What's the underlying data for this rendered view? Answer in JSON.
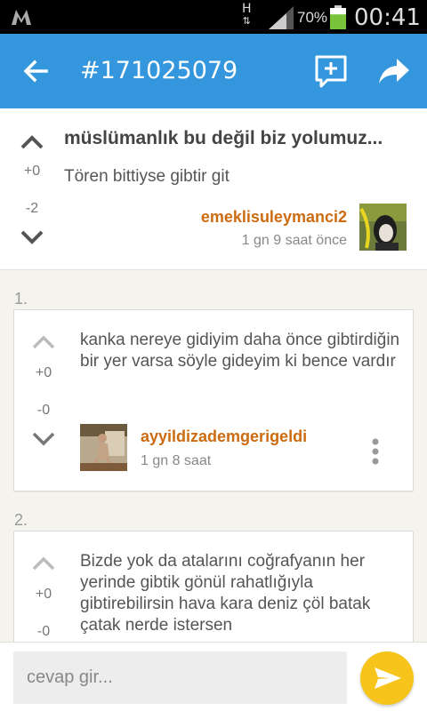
{
  "status_bar": {
    "network": "H",
    "battery_percent": "70%",
    "battery_level": 0.7,
    "time": "00:41"
  },
  "app_bar": {
    "title": "#171025079",
    "icons": [
      "back-arrow-icon",
      "add-comment-icon",
      "share-icon"
    ]
  },
  "post": {
    "title": "müslümanlık bu değil biz yolumuz...",
    "body": "Tören bittiyse gibtir git",
    "upvotes": "+0",
    "downvotes": "-2",
    "author": "emeklisuleymanci2",
    "time": "1 gn 9 saat  önce"
  },
  "comments": [
    {
      "index": "1.",
      "text": "kanka nereye gidiyim daha önce gibtirdiğin bir yer varsa söyle gideyim ki bence vardır",
      "upvotes": "+0",
      "downvotes": "-0",
      "author": "ayyildizademgerigeldi",
      "time": "1 gn 8 saat"
    },
    {
      "index": "2.",
      "text": "Bizde yok da atalarını coğrafyanın her yerinde gibtik gönül rahatlığıyla gibtirebilirsin hava kara deniz çöl batak çatak nerde istersen",
      "upvotes": "+0",
      "downvotes": "-0"
    }
  ],
  "reply": {
    "placeholder": "cevap gir..."
  },
  "colors": {
    "app_bar": "#3497dd",
    "author": "#cc6b10",
    "send_button": "#f6c41a",
    "background": "#f5f3ee"
  }
}
